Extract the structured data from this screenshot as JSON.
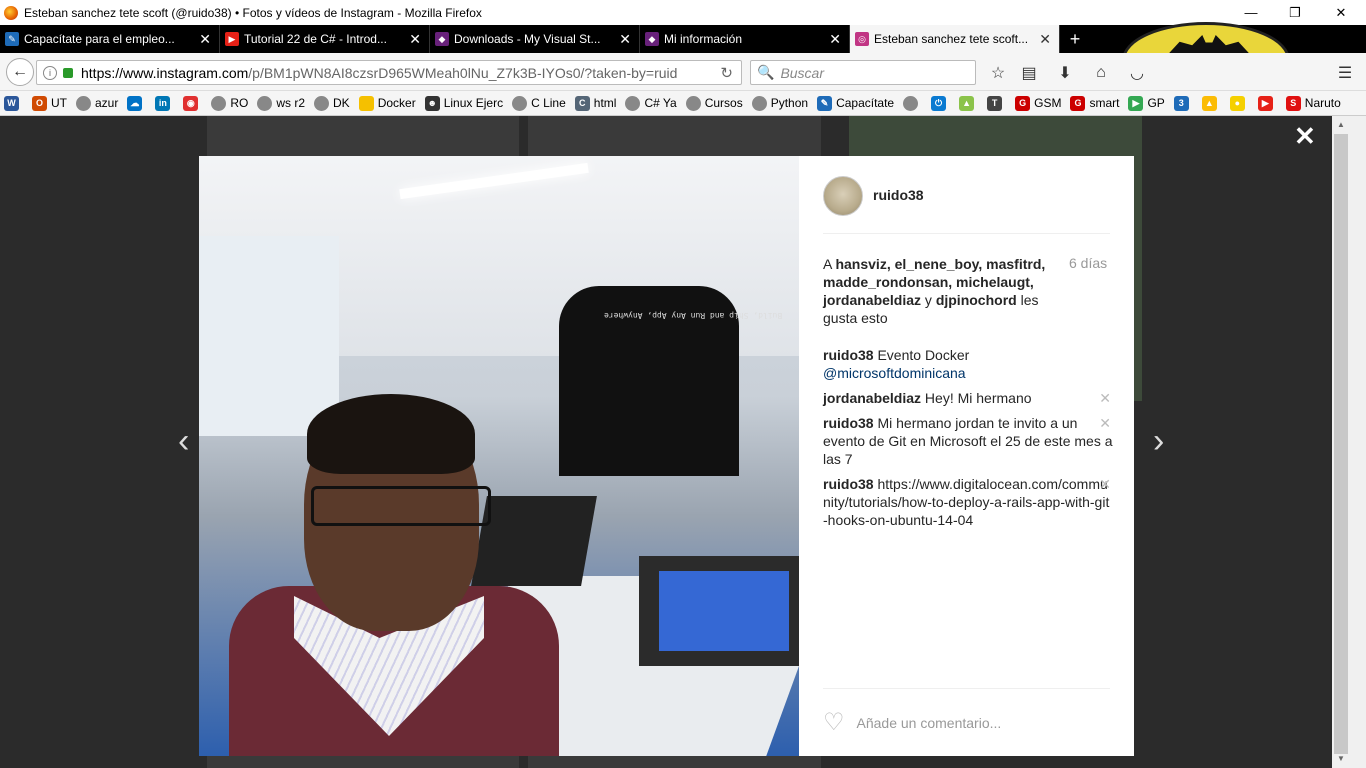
{
  "window": {
    "title": "Esteban sanchez tete scoft (@ruido38) • Fotos y vídeos de Instagram - Mozilla Firefox",
    "minimize": "—",
    "restore": "❐",
    "close": "✕"
  },
  "tabs": [
    {
      "label": "Capacítate para el empleo...",
      "close": "✕",
      "icon_color": "#1e6bb8",
      "icon": "capacitate-icon"
    },
    {
      "label": "Tutorial 22 de C# - Introd...",
      "close": "✕",
      "icon_color": "#e62117",
      "icon": "youtube-icon"
    },
    {
      "label": "Downloads - My Visual St...",
      "close": "✕",
      "icon_color": "#68217a",
      "icon": "visual-studio-icon"
    },
    {
      "label": "Mi información",
      "close": "✕",
      "icon_color": "#68217a",
      "icon": "visual-studio-icon"
    },
    {
      "label": "Esteban sanchez tete scoft...",
      "close": "✕",
      "icon_color": "#c13584",
      "icon": "instagram-icon"
    }
  ],
  "new_tab": "+",
  "nav": {
    "back": "←",
    "url_host": "https://www.instagram.com",
    "url_rest": "/p/BM1pWN8AI8czsrD965WMeah0lNu_Z7k3B-IYOs0/?taken-by=ruid",
    "reload": "↻",
    "search_placeholder": "Buscar",
    "search_icon": "🔍",
    "star": "☆",
    "reader": "▤",
    "download": "⬇",
    "home": "⌂",
    "pocket": "◡",
    "menu": "☰"
  },
  "bookmarks": [
    {
      "label": "UT",
      "icon_color": "#d04a02",
      "icon": "office-icon"
    },
    {
      "label": "azur",
      "icon_color": "#888",
      "icon": "globe-icon"
    },
    {
      "label": "",
      "icon_color": "#0072c6",
      "icon": "onedrive-icon"
    },
    {
      "label": "",
      "icon_color": "#0077b5",
      "icon": "linkedin-icon"
    },
    {
      "label": "",
      "icon_color": "#e03030",
      "icon": "app-icon"
    },
    {
      "label": "RO",
      "icon_color": "#888",
      "icon": "globe-icon"
    },
    {
      "label": "ws r2",
      "icon_color": "#888",
      "icon": "globe-icon"
    },
    {
      "label": "DK",
      "icon_color": "#888",
      "icon": "globe-icon"
    },
    {
      "label": "Docker",
      "icon_color": "#f5c000",
      "icon": "folder-icon"
    },
    {
      "label": "Linux Ejerc",
      "icon_color": "#333",
      "icon": "linux-icon"
    },
    {
      "label": "C Line",
      "icon_color": "#888",
      "icon": "globe-icon"
    },
    {
      "label": "html",
      "icon_color": "#567",
      "icon": "page-icon"
    },
    {
      "label": "C# Ya",
      "icon_color": "#888",
      "icon": "globe-icon"
    },
    {
      "label": "Cursos",
      "icon_color": "#888",
      "icon": "globe-icon"
    },
    {
      "label": "Python",
      "icon_color": "#888",
      "icon": "globe-icon"
    },
    {
      "label": "Capacítate",
      "icon_color": "#1e6bb8",
      "icon": "capacitate-icon"
    }
  ],
  "bookmarks_right": [
    {
      "label": "GSM",
      "icon_color": "#c00",
      "icon": "gsm-icon"
    },
    {
      "label": "smart",
      "icon_color": "#c00",
      "icon": "gsm-icon"
    },
    {
      "label": "GP",
      "icon_color": "#34a853",
      "icon": "play-icon"
    },
    {
      "label": "Naruto",
      "icon_color": "#e01010",
      "icon": "s-icon"
    }
  ],
  "page": {
    "close": "✕",
    "prev": "‹",
    "next": "›"
  },
  "post": {
    "username": "ruido38",
    "likes_users": "hansviz, el_nene_boy, masfitrd, madde_rondonsan, michelaugt, jordanabeldiaz",
    "likes_prefix": "A",
    "likes_and": "y",
    "likes_last": "djpinochord",
    "likes_suffix": "les gusta esto",
    "time": "6 días",
    "comments": [
      {
        "user": "ruido38",
        "text": "Evento Docker",
        "mention": "@microsoftdominicana",
        "delete": ""
      },
      {
        "user": "jordanabeldiaz",
        "text": "Hey! Mi hermano",
        "mention": "",
        "delete": "✕"
      },
      {
        "user": "ruido38",
        "text": "Mi hermano jordan te invito a un evento de Git en Microsoft el 25 de este mes a las 7",
        "mention": "",
        "delete": "✕"
      },
      {
        "user": "ruido38",
        "text": "https://www.digitalocean.com/community/tutorials/how-to-deploy-a-rails-app-with-git-hooks-on-ubuntu-14-04",
        "mention": "",
        "delete": "✕"
      }
    ],
    "heart": "♡",
    "add_comment_placeholder": "Añade un comentario...",
    "shirt_text": "Build, Ship and Run Any App, Anywhere"
  }
}
